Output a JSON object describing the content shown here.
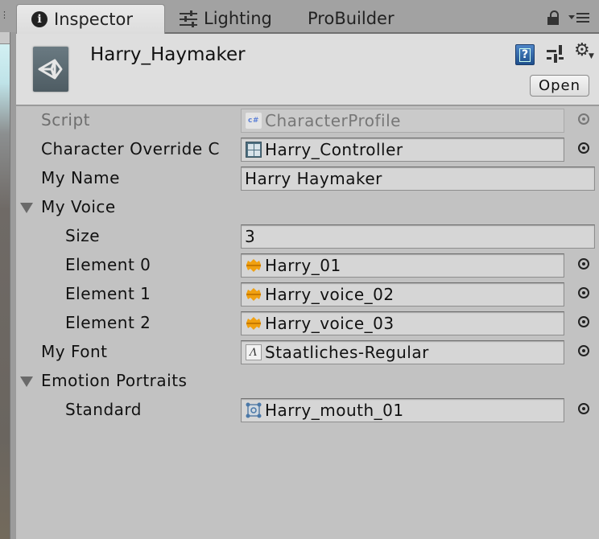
{
  "tabs": [
    {
      "label": "Inspector",
      "icon": "info-icon",
      "active": true
    },
    {
      "label": "Lighting",
      "icon": "sliders-icon",
      "active": false
    },
    {
      "label": "ProBuilder",
      "icon": null,
      "active": false
    }
  ],
  "header": {
    "object_name": "Harry_Haymaker",
    "help_glyph": "?",
    "gear_glyph": "⚙",
    "open_button": "Open"
  },
  "properties": {
    "script": {
      "label": "Script",
      "value": "CharacterProfile",
      "icon": "cs-script-icon",
      "cs_glyph": "c#"
    },
    "character_override": {
      "label": "Character Override C",
      "value": "Harry_Controller",
      "icon": "animator-controller-icon"
    },
    "my_name": {
      "label": "My Name",
      "value": "Harry Haymaker"
    },
    "my_voice": {
      "label": "My Voice",
      "expanded": true,
      "size": {
        "label": "Size",
        "value": "3"
      },
      "elements": [
        {
          "label": "Element 0",
          "value": "Harry_01",
          "icon": "audio-clip-icon"
        },
        {
          "label": "Element 1",
          "value": "Harry_voice_02",
          "icon": "audio-clip-icon"
        },
        {
          "label": "Element 2",
          "value": "Harry_voice_03",
          "icon": "audio-clip-icon"
        }
      ]
    },
    "my_font": {
      "label": "My Font",
      "value": "Staatliches-Regular",
      "icon": "font-icon",
      "font_glyph": "A"
    },
    "emotion_portraits": {
      "label": "Emotion Portraits",
      "expanded": true,
      "standard": {
        "label": "Standard",
        "value": "Harry_mouth_01",
        "icon": "sprite-icon"
      }
    }
  },
  "colors": {
    "panel_bg": "#c2c2c2",
    "header_bg": "#dedede",
    "tabbar_bg": "#a2a2a2",
    "audio_icon": "#f0a010"
  }
}
